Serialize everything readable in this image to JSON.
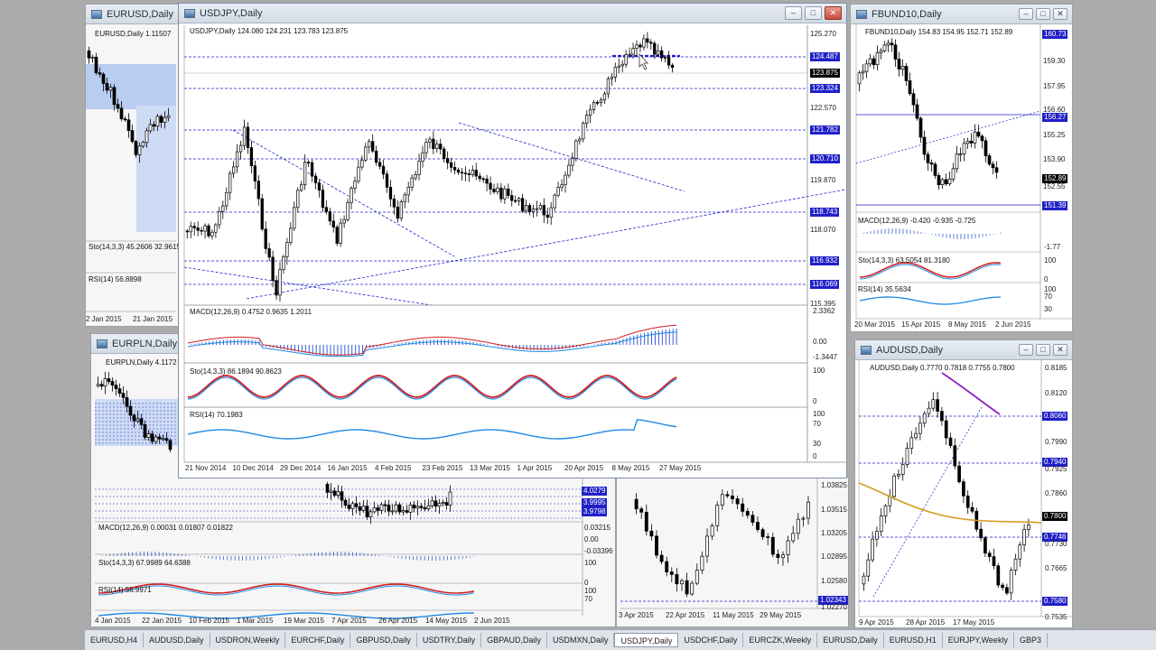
{
  "colors": {
    "accent": "#2020c8",
    "bull": "#000000",
    "bear": "#000000",
    "macd_signal": "#d02020",
    "rsi": "#1e88e5",
    "ma": "#d69a1e",
    "purple": "#8a22c2"
  },
  "windows": {
    "eurusd": {
      "title": "EURUSD,Daily",
      "header": "EURUSD,Daily  1.11507",
      "sto": "Sto(14,3,3) 45.2606 32.9615",
      "rsi": "RSI(14) 56.8898",
      "dates": [
        "2 Jan 2015",
        "21 Jan 2015"
      ]
    },
    "eurpln": {
      "title": "EURPLN,Daily",
      "header": "EURPLN,Daily  4.1172",
      "macd": "MACD(12,26,9) 0.00031 0.01807 0.01822",
      "sto": "Sto(14,3,3) 67.9989 64.6388",
      "rsi": "RSI(14) 56.9971",
      "prices": [
        "4.0279",
        "3.9995",
        "3.9798"
      ],
      "macd_ticks": [
        "0.03215",
        "0.00",
        "-0.03396"
      ],
      "sto_ticks": [
        "100",
        "0"
      ],
      "rsi_ticks": [
        "100",
        "70",
        "30",
        "0"
      ],
      "dates": [
        "4 Jan 2015",
        "22 Jan 2015",
        "10 Feb 2015",
        "1 Mar 2015",
        "19 Mar 2015",
        "7 Apr 2015",
        "26 Apr 2015",
        "14 May 2015",
        "2 Jun 2015"
      ]
    },
    "usdjpy": {
      "title": "USDJPY,Daily",
      "header": "USDJPY,Daily  124.080 124.231 123.783 123.875",
      "price_ticks": [
        "125.270",
        "124.487",
        "123.875",
        "123.324",
        "122.570",
        "121.782",
        "120.710",
        "119.870",
        "118.743",
        "118.070",
        "116.932",
        "116.069",
        "115.395"
      ],
      "macd": "MACD(12,26,9) 0.4752 0.9635 1.2011",
      "macd_ticks": [
        "2.3362",
        "0.00",
        "-1.3447"
      ],
      "sto": "Sto(14,3,3) 86.1894 90.8623",
      "sto_ticks": [
        "100",
        "0"
      ],
      "rsi": "RSI(14) 70.1983",
      "rsi_ticks": [
        "100",
        "70",
        "30",
        "0"
      ],
      "dates": [
        "21 Nov 2014",
        "10 Dec 2014",
        "29 Dec 2014",
        "16 Jan 2015",
        "4 Feb 2015",
        "23 Feb 2015",
        "13 Mar 2015",
        "1 Apr 2015",
        "20 Apr 2015",
        "8 May 2015",
        "27 May 2015"
      ]
    },
    "fbund": {
      "title": "FBUND10,Daily",
      "header": "FBUND10,Daily  154.83 154.95 152.71 152.89",
      "price_ticks": [
        "160.73",
        "159.30",
        "157.95",
        "156.60",
        "156.27",
        "155.25",
        "153.90",
        "152.89",
        "152.55",
        "151.39"
      ],
      "macd": "MACD(12,26,9) -0.420 -0.935 -0.725",
      "macd_ticks": [
        "1.7?",
        "-1.77"
      ],
      "sto": "Sto(14,3,3) 63.5054 81.3180",
      "sto_ticks": [
        "100",
        "0"
      ],
      "rsi": "RSI(14) 35.5634",
      "rsi_ticks": [
        "100",
        "70",
        "30"
      ],
      "dates": [
        "20 Mar 2015",
        "15 Apr 2015",
        "8 May 2015",
        "2 Jun 2015"
      ]
    },
    "audusd": {
      "title": "AUDUSD,Daily",
      "header": "AUDUSD,Daily  0.7770 0.7818 0.7755 0.7800",
      "price_ticks": [
        "0.8185",
        "0.8120",
        "0.8060",
        "0.7990",
        "0.7940",
        "0.7925",
        "0.7860",
        "0.7800",
        "0.7746",
        "0.7730",
        "0.7665",
        "0.7600",
        "0.7580",
        "0.7535"
      ],
      "dates": [
        "9 Apr 2015",
        "28 Apr 2015",
        "17 May 2015"
      ]
    },
    "eurczk": {
      "price_ticks": [
        "1.03825",
        "1.03515",
        "1.03205",
        "1.02895",
        "1.02580",
        "1.02343",
        "1.02270"
      ],
      "dates": [
        "3 Apr 2015",
        "22 Apr 2015",
        "11 May 2015",
        "29 May 2015"
      ]
    }
  },
  "taskbar": {
    "tabs": [
      "EURUSD,H4",
      "AUDUSD,Daily",
      "USDRON,Weekly",
      "EURCHF,Daily",
      "GBPUSD,Daily",
      "USDTRY,Daily",
      "GBPAUD,Daily",
      "USDMXN,Daily",
      "USDJPY,Daily",
      "USDCHF,Daily",
      "EURCZK,Weekly",
      "EURUSD,Daily",
      "EURUSD,H1",
      "EURJPY,Weekly",
      "GBP3"
    ],
    "active": 8
  }
}
